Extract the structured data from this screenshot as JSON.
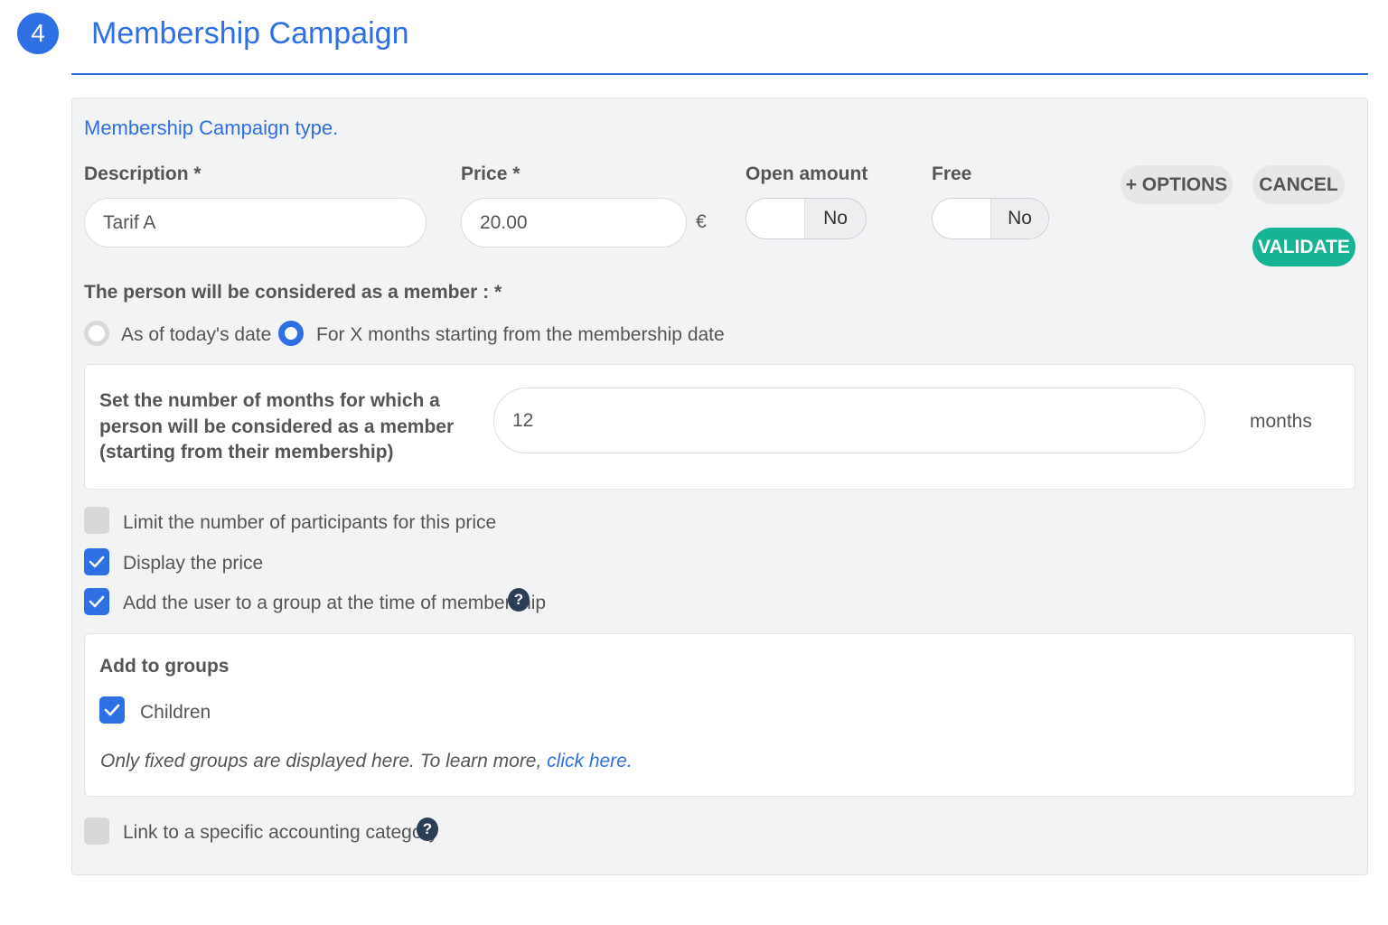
{
  "header": {
    "step_number": "4",
    "title": "Membership Campaign"
  },
  "form": {
    "section_title": "Membership Campaign type.",
    "description": {
      "label": "Description *",
      "value": "Tarif A"
    },
    "price": {
      "label": "Price *",
      "value": "20.00",
      "currency": "€"
    },
    "open_amount": {
      "label": "Open amount",
      "state": "No"
    },
    "free": {
      "label": "Free",
      "state": "No"
    },
    "buttons": {
      "options": "+ OPTIONS",
      "cancel": "CANCEL",
      "validate": "VALIDATE"
    },
    "member_rule": {
      "label": "The person will be considered as a member : *",
      "options": [
        {
          "label": "As of today's date",
          "selected": false
        },
        {
          "label": "For X months starting from the membership date",
          "selected": true
        }
      ]
    },
    "months_panel": {
      "label": "Set the number of months for which a person will be considered as a member (starting from their membership)",
      "value": "12",
      "unit": "months"
    },
    "checkboxes": [
      {
        "label": "Limit the number of participants for this price",
        "checked": false
      },
      {
        "label": "Display the price",
        "checked": true
      },
      {
        "label": "Add the user to a group at the time of membership",
        "checked": true
      }
    ],
    "groups_panel": {
      "title": "Add to groups",
      "groups": [
        {
          "label": "Children",
          "checked": true
        }
      ],
      "hint_text": "Only fixed groups are displayed here. To learn more, ",
      "hint_link": "click here",
      "hint_end": "."
    },
    "accounting": {
      "label": "Link to a specific accounting category",
      "checked": false
    }
  },
  "icons": {
    "check": "check-icon",
    "help": "help-circle-icon"
  },
  "colors": {
    "accent": "#2f6fe4",
    "validate": "#16b394",
    "card_bg": "#f2f3f5"
  }
}
